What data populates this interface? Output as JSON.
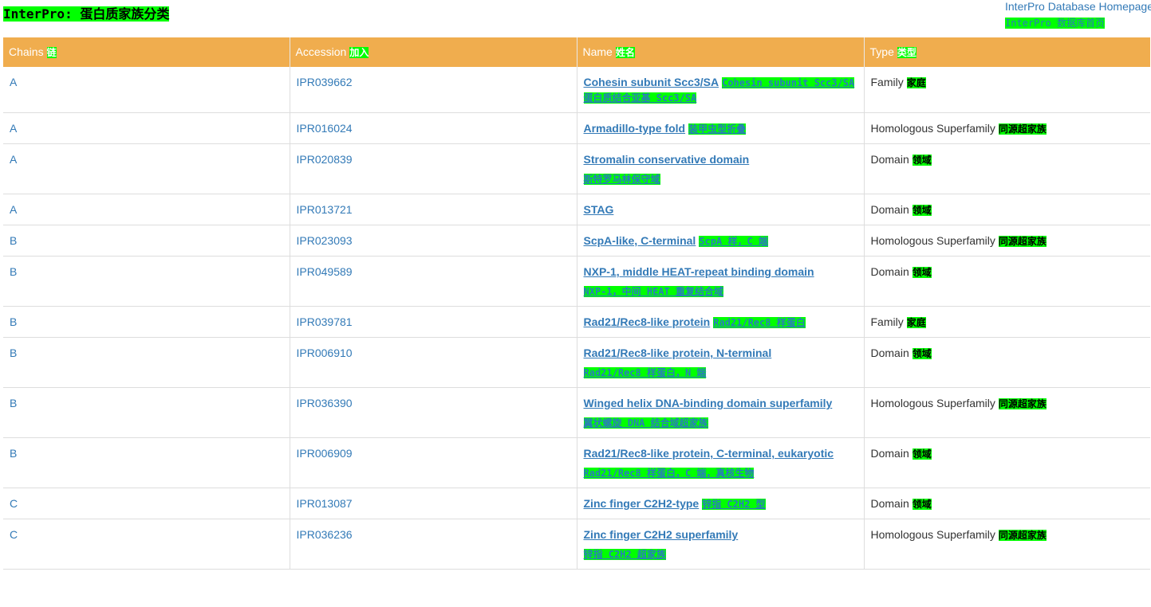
{
  "page": {
    "title": "InterPro: 蛋白质家族分类",
    "homepage_link": "InterPro Database Homepage",
    "homepage_link_zh": "InterPro 数据库首页"
  },
  "table": {
    "headers": [
      {
        "en": "Chains",
        "zh": "链"
      },
      {
        "en": "Accession",
        "zh": "加入"
      },
      {
        "en": "Name",
        "zh": "姓名"
      },
      {
        "en": "Type",
        "zh": "类型"
      }
    ],
    "rows": [
      {
        "chain": "A",
        "accession": "IPR039662",
        "name": "Cohesin subunit Scc3/SA",
        "name_zh": "Cohesin subunit Scc3/SA",
        "name_zh2": "蛋白质结合亚基 Scc3/SA",
        "type": "Family",
        "type_zh": "家庭"
      },
      {
        "chain": "A",
        "accession": "IPR016024",
        "name": "Armadillo-type fold",
        "name_zh": "装甲虫型折叠",
        "type": "Homologous Superfamily",
        "type_zh": "同源超家族"
      },
      {
        "chain": "A",
        "accession": "IPR020839",
        "name": "Stromalin conservative domain",
        "name_zh": "斯特罗马林保守域",
        "type": "Domain",
        "type_zh": "领域"
      },
      {
        "chain": "A",
        "accession": "IPR013721",
        "name": "STAG",
        "name_zh": "",
        "type": "Domain",
        "type_zh": "领域"
      },
      {
        "chain": "B",
        "accession": "IPR023093",
        "name": "ScpA-like, C-terminal",
        "name_zh": "ScpA 样，C 端",
        "type": "Homologous Superfamily",
        "type_zh": "同源超家族"
      },
      {
        "chain": "B",
        "accession": "IPR049589",
        "name": "NXP-1, middle HEAT-repeat binding domain",
        "name_zh": "NXP-1，中间 HEAT 重复结合域",
        "type": "Domain",
        "type_zh": "领域"
      },
      {
        "chain": "B",
        "accession": "IPR039781",
        "name": "Rad21/Rec8-like protein",
        "name_zh": "Rad21/Rec8 样蛋白",
        "type": "Family",
        "type_zh": "家庭"
      },
      {
        "chain": "B",
        "accession": "IPR006910",
        "name": "Rad21/Rec8-like protein, N-terminal",
        "name_zh": "Rad21/Rec8 样蛋白，N 端",
        "type": "Domain",
        "type_zh": "领域"
      },
      {
        "chain": "B",
        "accession": "IPR036390",
        "name": "Winged helix DNA-binding domain superfamily",
        "name_zh": "翼状螺旋 DNA 结合域超家族",
        "type": "Homologous Superfamily",
        "type_zh": "同源超家族"
      },
      {
        "chain": "B",
        "accession": "IPR006909",
        "name": "Rad21/Rec8-like protein, C-terminal, eukaryotic",
        "name_zh": "Rad21/Rec8 样蛋白，C 端，真核生物",
        "type": "Domain",
        "type_zh": "领域"
      },
      {
        "chain": "C",
        "accession": "IPR013087",
        "name": "Zinc finger C2H2-type",
        "name_zh": "锌指 C2H2 型",
        "type": "Domain",
        "type_zh": "领域"
      },
      {
        "chain": "C",
        "accession": "IPR036236",
        "name": "Zinc finger C2H2 superfamily",
        "name_zh": "锌指 C2H2 超家族",
        "type": "Homologous Superfamily",
        "type_zh": "同源超家族"
      }
    ]
  },
  "colors": {
    "header_bg": "#f0ad4e",
    "link": "#337ab7",
    "highlight": "#00ff00"
  }
}
